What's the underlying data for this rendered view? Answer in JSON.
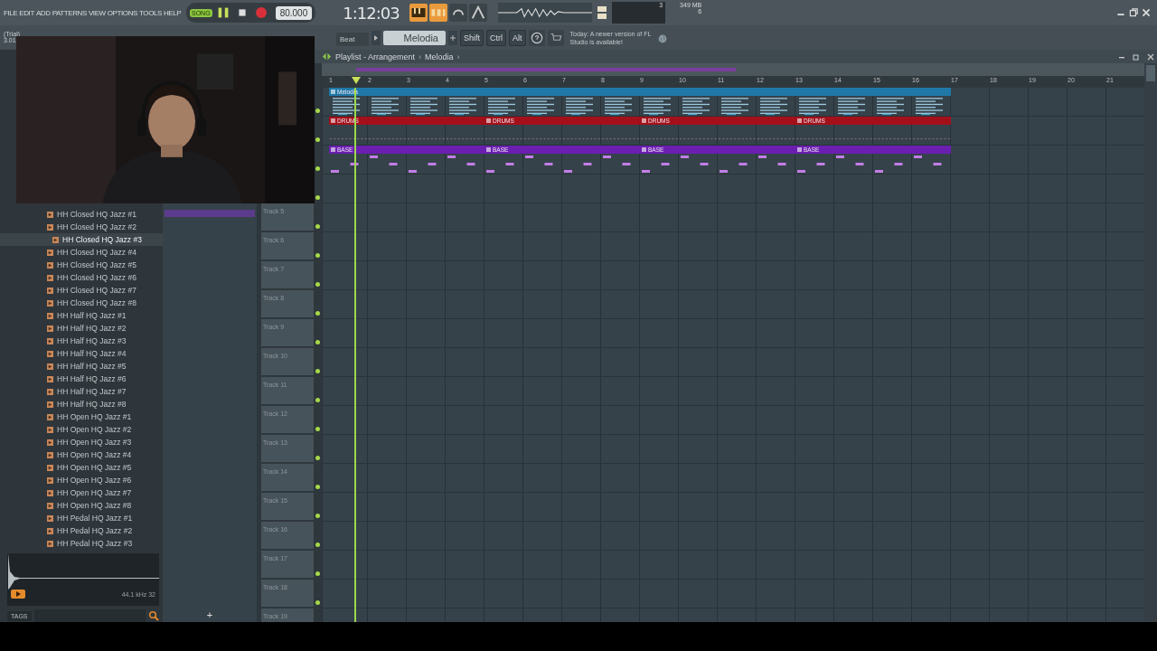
{
  "menu": [
    "FILE",
    "EDIT",
    "ADD",
    "PATTERNS",
    "VIEW",
    "OPTIONS",
    "TOOLS",
    "HELP"
  ],
  "transport": {
    "mode": "SONG",
    "song_mode": true,
    "tempo": "80.000",
    "time": "1:12:03"
  },
  "monitor": {
    "cpu": "3",
    "memory": "349 MB",
    "polyphony": "6"
  },
  "app_info": {
    "license": "(Trial)",
    "version": "3.01"
  },
  "toolbar": {
    "snap": "Beat",
    "pattern": "Melodia",
    "modifiers": [
      "Shift",
      "Ctrl",
      "Alt"
    ],
    "hint": "Today: A newer version of FL Studio is available!"
  },
  "playlist": {
    "breadcrumb": [
      {
        "label": "Playlist - Arrangement",
        "sep": "›"
      },
      {
        "label": "Melodia",
        "sep": "›"
      }
    ],
    "add_track": "+",
    "ruler": [
      "1",
      "2",
      "3",
      "4",
      "5",
      "6",
      "7",
      "8",
      "9",
      "10",
      "11",
      "12",
      "13",
      "14",
      "15",
      "16",
      "17",
      "18",
      "19",
      "20",
      "21"
    ],
    "tracks": [
      {
        "enabled": true,
        "clips": [
          {
            "label": "Melodia",
            "color": "#1f78a8",
            "kind": "melody"
          }
        ]
      },
      {
        "enabled": true,
        "clips": [
          {
            "label": "DRUMS",
            "color": "#a3101a",
            "kind": "drums"
          },
          {
            "label": "DRUMS",
            "color": "#a3101a",
            "kind": "drums"
          },
          {
            "label": "DRUMS",
            "color": "#a3101a",
            "kind": "drums"
          },
          {
            "label": "DRUMS",
            "color": "#a3101a",
            "kind": "drums"
          }
        ]
      },
      {
        "enabled": true,
        "clips": [
          {
            "label": "BASE",
            "color": "#6a1fb0",
            "kind": "bass"
          },
          {
            "label": "BASE",
            "color": "#6a1fb0",
            "kind": "bass"
          },
          {
            "label": "BASE",
            "color": "#6a1fb0",
            "kind": "bass"
          },
          {
            "label": "BASE",
            "color": "#6a1fb0",
            "kind": "bass"
          }
        ]
      },
      {
        "enabled": true
      },
      {
        "name": "Track 5",
        "enabled": true
      },
      {
        "name": "Track 6",
        "enabled": true
      },
      {
        "name": "Track 7",
        "enabled": true
      },
      {
        "name": "Track 8",
        "enabled": true
      },
      {
        "name": "Track 9",
        "enabled": true
      },
      {
        "name": "Track 10",
        "enabled": true
      },
      {
        "name": "Track 11",
        "enabled": true
      },
      {
        "name": "Track 12",
        "enabled": true
      },
      {
        "name": "Track 13",
        "enabled": true
      },
      {
        "name": "Track 14",
        "enabled": true
      },
      {
        "name": "Track 15",
        "enabled": true
      },
      {
        "name": "Track 16",
        "enabled": true
      },
      {
        "name": "Track 17",
        "enabled": true
      },
      {
        "name": "Track 18",
        "enabled": true
      },
      {
        "name": "Track 19"
      }
    ]
  },
  "browser": {
    "items": [
      {
        "label": "HH Closed HQ Jazz #1",
        "selected": false
      },
      {
        "label": "HH Closed HQ Jazz #2",
        "selected": false
      },
      {
        "label": "HH Closed HQ Jazz #3",
        "selected": true
      },
      {
        "label": "HH Closed HQ Jazz #4",
        "selected": false
      },
      {
        "label": "HH Closed HQ Jazz #5",
        "selected": false
      },
      {
        "label": "HH Closed HQ Jazz #6",
        "selected": false
      },
      {
        "label": "HH Closed HQ Jazz #7",
        "selected": false
      },
      {
        "label": "HH Closed HQ Jazz #8",
        "selected": false
      },
      {
        "label": "HH Half HQ Jazz #1",
        "selected": false
      },
      {
        "label": "HH Half HQ Jazz #2",
        "selected": false
      },
      {
        "label": "HH Half HQ Jazz #3",
        "selected": false
      },
      {
        "label": "HH Half HQ Jazz #4",
        "selected": false
      },
      {
        "label": "HH Half HQ Jazz #5",
        "selected": false
      },
      {
        "label": "HH Half HQ Jazz #6",
        "selected": false
      },
      {
        "label": "HH Half HQ Jazz #7",
        "selected": false
      },
      {
        "label": "HH Half HQ Jazz #8",
        "selected": false
      },
      {
        "label": "HH Open HQ Jazz #1",
        "selected": false
      },
      {
        "label": "HH Open HQ Jazz #2",
        "selected": false
      },
      {
        "label": "HH Open HQ Jazz #3",
        "selected": false
      },
      {
        "label": "HH Open HQ Jazz #4",
        "selected": false
      },
      {
        "label": "HH Open HQ Jazz #5",
        "selected": false
      },
      {
        "label": "HH Open HQ Jazz #6",
        "selected": false
      },
      {
        "label": "HH Open HQ Jazz #7",
        "selected": false
      },
      {
        "label": "HH Open HQ Jazz #8",
        "selected": false
      },
      {
        "label": "HH Pedal HQ Jazz #1",
        "selected": false
      },
      {
        "label": "HH Pedal HQ Jazz #2",
        "selected": false
      },
      {
        "label": "HH Pedal HQ Jazz #3",
        "selected": false
      }
    ],
    "sample_info": "44.1 kHz 32",
    "tags_label": "TAGS"
  }
}
